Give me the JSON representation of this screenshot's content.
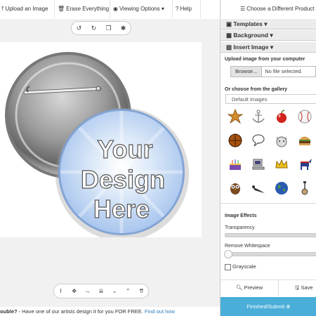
{
  "toolbar": {
    "upload_label": "Upload an Image",
    "erase_label": "Erase Everything",
    "viewing_label": "Viewing Options",
    "help_label": "Help",
    "choose_product_label": "Choose a Different Product"
  },
  "canvas": {
    "undo_icons": [
      "undo-icon",
      "redo-icon",
      "copy-icon",
      "settings-icon"
    ],
    "button_text": [
      "Your",
      "Design",
      "Here"
    ],
    "bottom_tool_icons": [
      "text-cursor-icon",
      "move-icon",
      "resize-horizontal-icon",
      "chevron-down-double-icon",
      "chevron-down-icon",
      "chevron-up-icon",
      "chevron-up-double-icon"
    ]
  },
  "footer": {
    "prefix": "ouble?",
    "message": " - Have one of our artists design it for you FOR FREE. ",
    "link": "Find out how"
  },
  "sidebar": {
    "templates_label": "Templates",
    "background_label": "Background",
    "insert_image_label": "Insert Image",
    "upload_heading": "Upload image from your computer",
    "browse_label": "Browse...",
    "no_file_label": "No file selected.",
    "gallery_heading": "Or choose from the gallery",
    "gallery_select": "Default Images",
    "gallery_items": [
      "sheriff-star",
      "anchor",
      "apple",
      "baseball",
      "basketball",
      "speech-bubble",
      "cat-face",
      "hamburger",
      "birthday-cake",
      "computer",
      "crown",
      "democrat-donkey",
      "owl",
      "bird",
      "earth-globe",
      "guitar"
    ],
    "effects_heading": "Image Effects",
    "transparency_label": "Transparency",
    "whitespace_label": "Remove Whitespace",
    "grayscale_label": "Grayscale",
    "preview_label": "Preview",
    "save_label": "Save",
    "finish_label": "Finished/Submit"
  },
  "colors": {
    "accent": "#4aaed9",
    "link": "#2a7ab8",
    "button_blue": "#b9d3f0"
  }
}
